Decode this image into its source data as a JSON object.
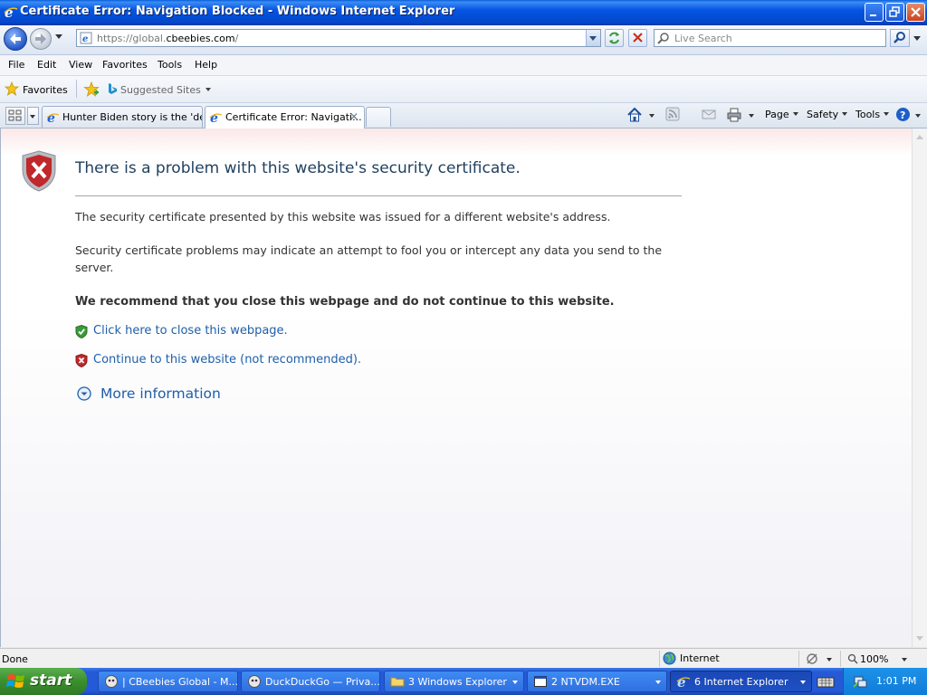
{
  "window": {
    "title": "Certificate Error: Navigation Blocked - Windows Internet Explorer"
  },
  "address_bar": {
    "url_prefix": "https://global.",
    "url_domain": "cbeebies.com",
    "url_suffix": "/"
  },
  "search": {
    "placeholder": "Live Search"
  },
  "menu": [
    "File",
    "Edit",
    "View",
    "Favorites",
    "Tools",
    "Help"
  ],
  "favorites_bar": {
    "favorites_label": "Favorites",
    "suggested_label": "Suggested Sites"
  },
  "tabs": [
    {
      "label": "Hunter Biden story is the 'de...",
      "active": false
    },
    {
      "label": "Certificate Error: Navigati...",
      "active": true
    }
  ],
  "command_bar": {
    "page": "Page",
    "safety": "Safety",
    "tools": "Tools"
  },
  "error_page": {
    "title": "There is a problem with this website's security certificate.",
    "paragraph1": "The security certificate presented by this website was issued for a different website's address.",
    "paragraph2": "Security certificate problems may indicate an attempt to fool you or intercept any data you send to the server.",
    "recommendation": "We recommend that you close this webpage and do not continue to this website.",
    "close_link": "Click here to close this webpage.",
    "continue_link": "Continue to this website (not recommended).",
    "more_info": "More information"
  },
  "status_bar": {
    "status": "Done",
    "zone": "Internet",
    "zoom": "100%"
  },
  "taskbar": {
    "start_label": "start",
    "tasks": [
      {
        "label": "| CBeebies Global - M...",
        "active": false
      },
      {
        "label": "DuckDuckGo — Priva...",
        "active": false
      },
      {
        "label": "3 Windows Explorer",
        "active": false
      },
      {
        "label": "2 NTVDM.EXE",
        "active": false
      },
      {
        "label": "6 Internet Explorer",
        "active": true
      }
    ],
    "clock": "1:01 PM"
  },
  "colors": {
    "titlebar": "#0554e3",
    "link": "#1e5fa8",
    "error_red": "#c0282b",
    "ok_green": "#3a9a3a"
  }
}
